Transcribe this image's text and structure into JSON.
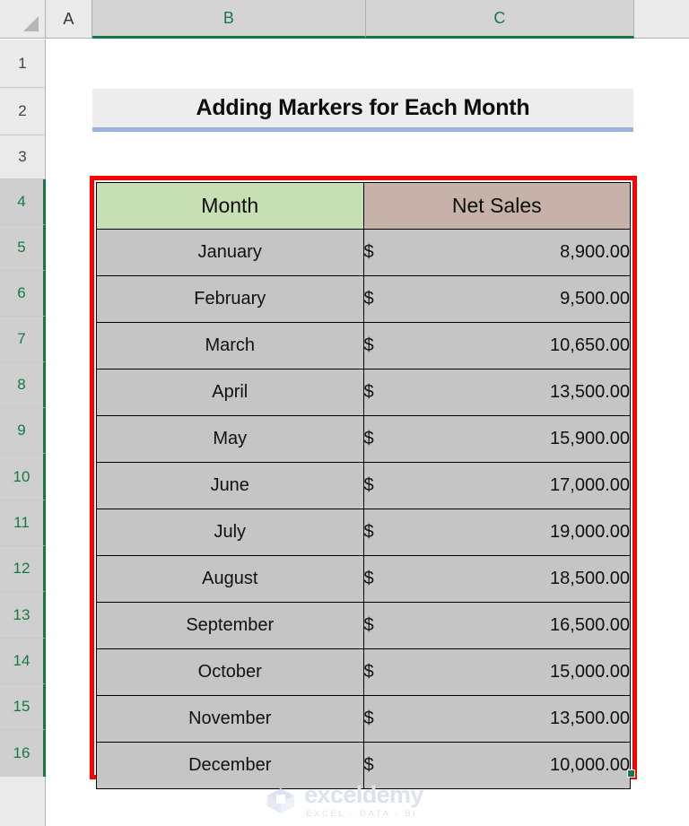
{
  "spreadsheet": {
    "app": "excel",
    "column_headers": [
      "A",
      "B",
      "C"
    ],
    "selected_columns": [
      "B",
      "C"
    ],
    "row_headers": [
      "1",
      "2",
      "3",
      "4",
      "5",
      "6",
      "7",
      "8",
      "9",
      "10",
      "11",
      "12",
      "13",
      "14",
      "15",
      "16"
    ],
    "selected_rows": [
      "4",
      "5",
      "6",
      "7",
      "8",
      "9",
      "10",
      "11",
      "12",
      "13",
      "14",
      "15",
      "16"
    ],
    "select_all_icon": "select-all-triangle-icon"
  },
  "title": {
    "text": "Adding Markers for Each Month",
    "background_color": "#EDEDED",
    "underline_color": "#9DB2E0"
  },
  "table": {
    "headers": [
      "Month",
      "Net Sales"
    ],
    "header_colors": [
      "#C6E0B4",
      "#C6B2A8"
    ],
    "cell_color": "#C5C5C5",
    "selection_border_color": "#FF0000",
    "fill_handle_color": "#147A43",
    "currency_symbol": "$",
    "rows": [
      {
        "month": "January",
        "amount": "8,900.00"
      },
      {
        "month": "February",
        "amount": "9,500.00"
      },
      {
        "month": "March",
        "amount": "10,650.00"
      },
      {
        "month": "April",
        "amount": "13,500.00"
      },
      {
        "month": "May",
        "amount": "15,900.00"
      },
      {
        "month": "June",
        "amount": "17,000.00"
      },
      {
        "month": "July",
        "amount": "19,000.00"
      },
      {
        "month": "August",
        "amount": "18,500.00"
      },
      {
        "month": "September",
        "amount": "16,500.00"
      },
      {
        "month": "October",
        "amount": "15,000.00"
      },
      {
        "month": "November",
        "amount": "13,500.00"
      },
      {
        "month": "December",
        "amount": "10,000.00"
      }
    ]
  },
  "watermark": {
    "logo_icon": "exceldemy-cube-logo-icon",
    "name": "exceldemy",
    "tagline": "EXCEL - DATA - BI",
    "color": "#DDE2F1"
  }
}
